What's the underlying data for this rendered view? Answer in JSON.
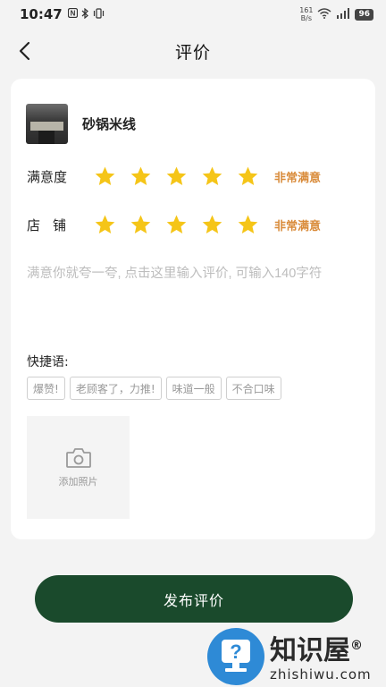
{
  "status_bar": {
    "time": "10:47",
    "left_icons": [
      "nfc-icon",
      "bluetooth-icon",
      "vibrate-icon"
    ],
    "net_speed_value": "161",
    "net_speed_unit": "B/s",
    "battery": "96"
  },
  "nav": {
    "title": "评价",
    "back_icon": "chevron-left-icon"
  },
  "shop": {
    "name": "砂锅米线"
  },
  "ratings": [
    {
      "label": "满意度",
      "stars": 5,
      "max": 5,
      "text": "非常满意"
    },
    {
      "label": "店铺",
      "stars": 5,
      "max": 5,
      "text": "非常满意"
    }
  ],
  "review": {
    "placeholder": "满意你就夸一夸, 点击这里输入评价, 可输入140字符",
    "value": ""
  },
  "quick_phrases": {
    "label": "快捷语:",
    "tags": [
      "爆赞!",
      "老顾客了，力推!",
      "味道一般",
      "不合口味"
    ]
  },
  "photo": {
    "label": "添加照片",
    "icon": "camera-icon"
  },
  "publish_button": "发布评价",
  "watermark": {
    "cn": "知识屋",
    "en": "zhishiwu.com",
    "registered": "®"
  },
  "colors": {
    "star": "#f5c518",
    "rating_text": "#d98b3a",
    "button": "#1a4a2c",
    "watermark_logo": "#2e8ad6"
  }
}
